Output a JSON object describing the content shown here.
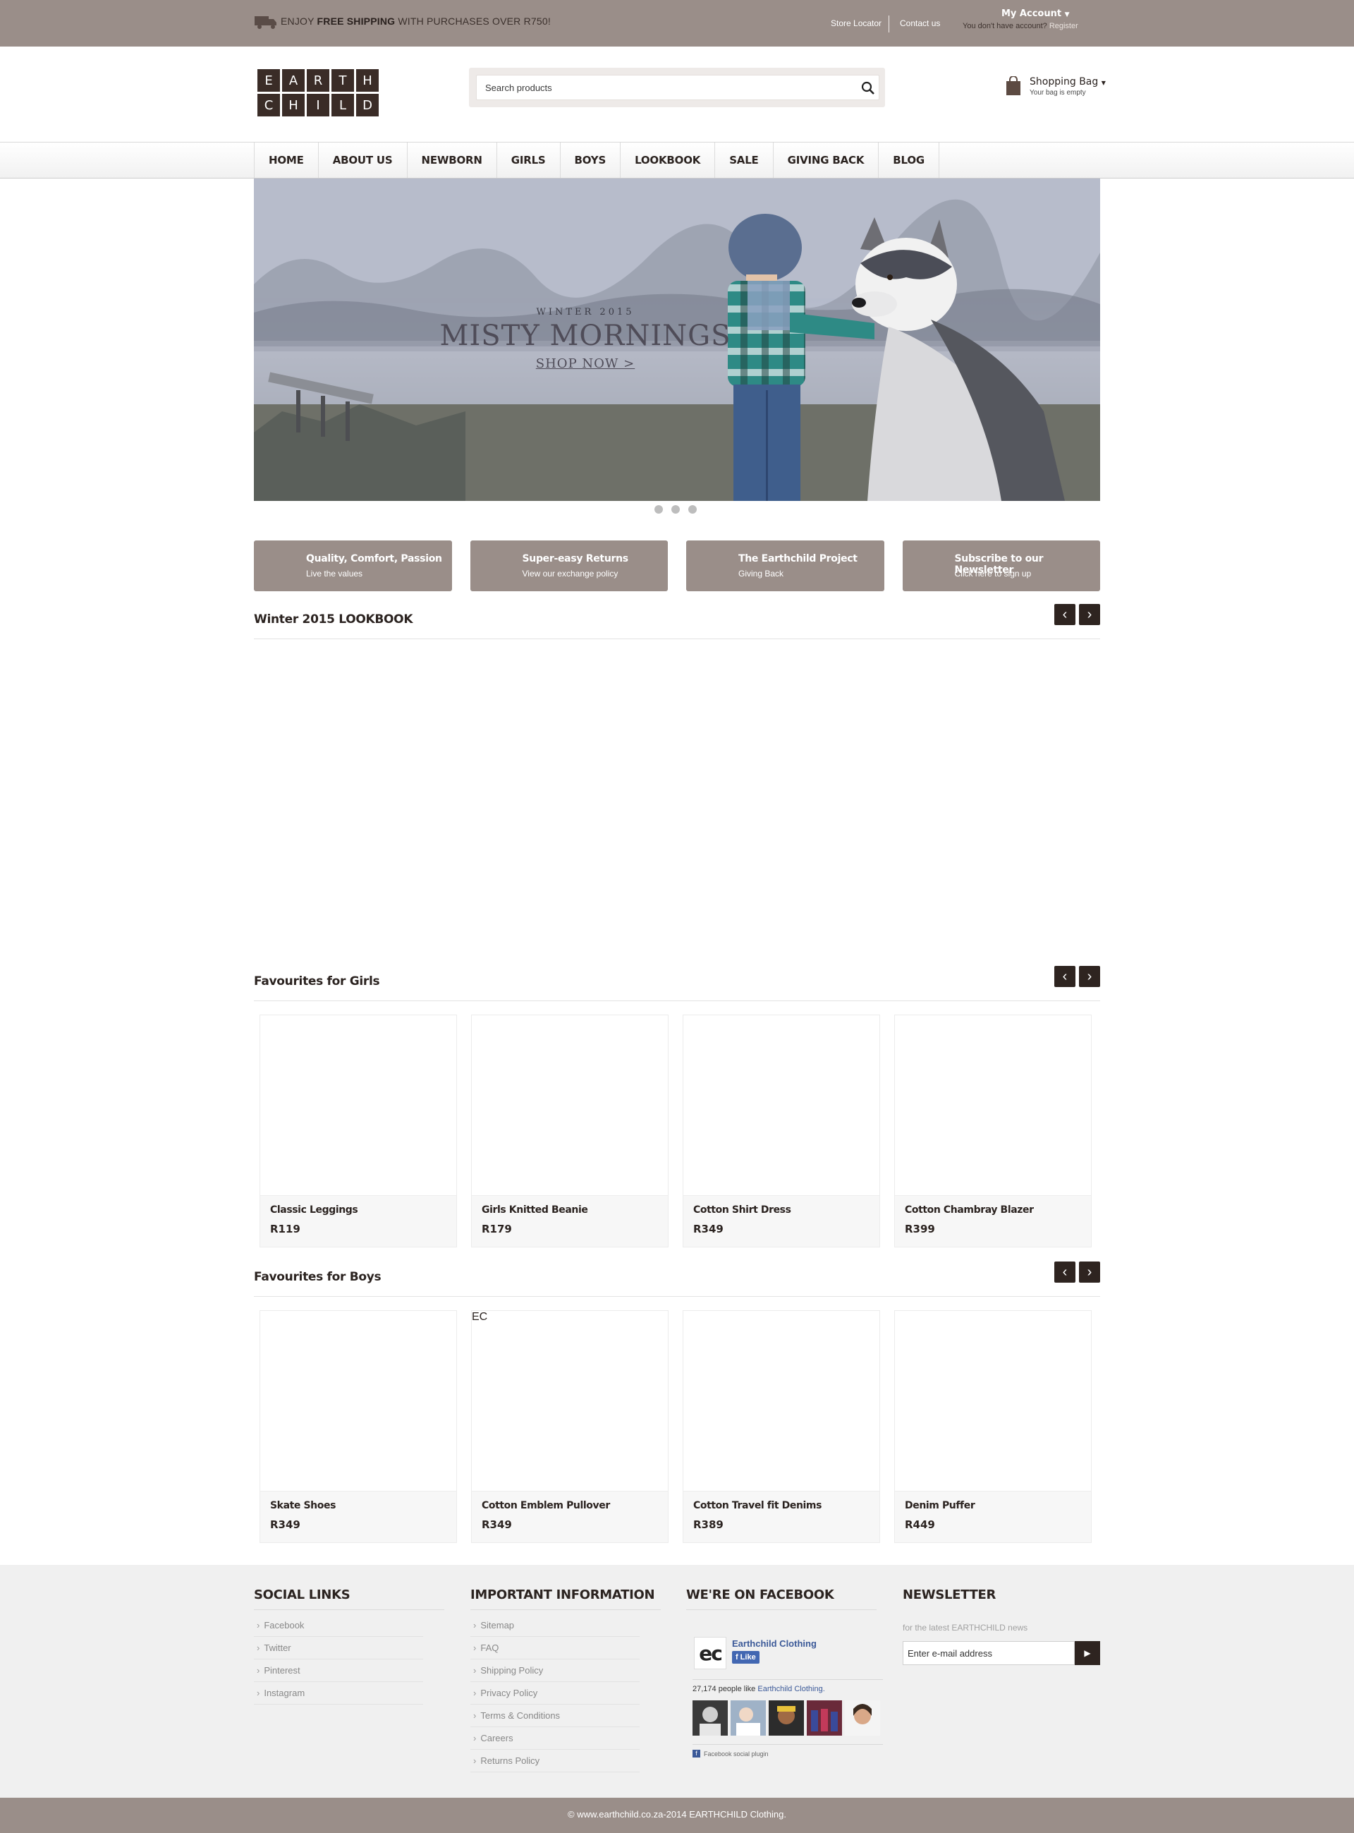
{
  "topbar": {
    "shipping_prefix": "ENJOY ",
    "shipping_bold": "FREE SHIPPING",
    "shipping_suffix": " WITH PURCHASES OVER R750!",
    "store_locator": "Store Locator",
    "contact_us": "Contact us",
    "account_label": "My Account",
    "account_prompt": "You don't have account?",
    "register": "Register"
  },
  "logo": {
    "letters": [
      "E",
      "A",
      "R",
      "T",
      "H",
      "C",
      "H",
      "I",
      "L",
      "D"
    ]
  },
  "search": {
    "placeholder": "Search products"
  },
  "bag": {
    "title": "Shopping Bag",
    "status": "Your bag is empty"
  },
  "nav": [
    "HOME",
    "ABOUT US",
    "NEWBORN",
    "GIRLS",
    "BOYS",
    "LOOKBOOK",
    "SALE",
    "GIVING BACK",
    "BLOG"
  ],
  "hero": {
    "kicker": "WINTER 2015",
    "title": "MISTY MORNINGS",
    "cta": "SHOP NOW >",
    "slides": 3
  },
  "features": [
    {
      "title": "Quality, Comfort, Passion",
      "subtitle": "Live the values",
      "icon": "sunburst-icon"
    },
    {
      "title": "Super-easy Returns",
      "subtitle": "View our exchange policy",
      "icon": "cart-return-icon"
    },
    {
      "title": "The Earthchild Project",
      "subtitle": "Giving Back",
      "icon": "gift-icon"
    },
    {
      "title": "Subscribe to our Newsletter",
      "subtitle": "Click here to sign up",
      "icon": "stamp-icon"
    }
  ],
  "lookbook": {
    "title": "Winter 2015 LOOKBOOK"
  },
  "girls": {
    "title": "Favourites for Girls",
    "products": [
      {
        "name": "Classic Leggings",
        "price": "R119"
      },
      {
        "name": "Girls Knitted Beanie",
        "price": "R179"
      },
      {
        "name": "Cotton Shirt Dress",
        "price": "R349"
      },
      {
        "name": "Cotton Chambray Blazer",
        "price": "R399"
      }
    ]
  },
  "boys": {
    "title": "Favourites for Boys",
    "products": [
      {
        "name": "Skate Shoes",
        "price": "R349"
      },
      {
        "name": "Cotton Emblem Pullover",
        "price": "R349"
      },
      {
        "name": "Cotton Travel fit Denims",
        "price": "R389"
      },
      {
        "name": "Denim Puffer",
        "price": "R449"
      }
    ]
  },
  "footer": {
    "social_title": "SOCIAL LINKS",
    "social_links": [
      "Facebook",
      "Twitter",
      "Pinterest",
      "Instagram"
    ],
    "info_title": "IMPORTANT INFORMATION",
    "info_links": [
      "Sitemap",
      "FAQ",
      "Shipping Policy",
      "Privacy Policy",
      "Terms & Conditions",
      "Careers",
      "Returns Policy"
    ],
    "facebook_title": "WE'RE ON FACEBOOK",
    "fb_logo_text": "ec",
    "fb_page_name": "Earthchild Clothing",
    "fb_like": "Like",
    "fb_count": "27,174 people like ",
    "fb_count_link": "Earthchild Clothing.",
    "fb_plugin": "Facebook social plugin",
    "newsletter_title": "NEWSLETTER",
    "newsletter_text": "for the latest EARTHCHILD news",
    "newsletter_placeholder": "Enter e-mail address",
    "newsletter_button": "▶"
  },
  "copyright": "© www.earthchild.co.za-2014 EARTHCHILD Clothing.",
  "colors": {
    "brand_taupe": "#9a8e89",
    "brand_dark": "#2e2420",
    "facebook_blue": "#3b5998"
  }
}
